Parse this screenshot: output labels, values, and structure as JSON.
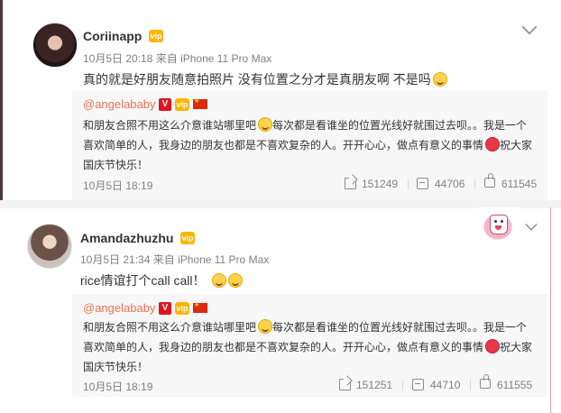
{
  "posts": [
    {
      "username": "Coriinapp",
      "time": "10月5日 20:18",
      "source": "来自 iPhone 11 Pro Max",
      "content": "真的就是好朋友随意拍照片 没有位置之分才是真朋友啊 不是吗",
      "repost": {
        "user": "@angelababy",
        "text_l1a": "和朋友合照不用这么介意谁站哪里吧",
        "text_l1b": "每次都是看谁坐的位置光线好就围过去呗。。我是一个",
        "text_l2a": "喜欢简单的人，我身边的朋友也都是不喜欢复杂的人。开开心心，做点有意义的事情",
        "text_l2b": "祝大家",
        "text_l3": "国庆节快乐！",
        "date": "10月5日 18:19",
        "reposts": "151249",
        "comments": "44706",
        "likes": "611545"
      }
    },
    {
      "username": "Amandazhuzhu",
      "time": "10月5日 21:34",
      "source": "来自 iPhone 11 Pro Max",
      "content": "rice情谊打个call call！",
      "repost": {
        "user": "@angelababy",
        "text_l1a": "和朋友合照不用这么介意谁站哪里吧",
        "text_l1b": "每次都是看谁坐的位置光线好就围过去呗。。我是一个",
        "text_l2a": "喜欢简单的人，我身边的朋友也都是不喜欢复杂的人。开开心心，做点有意义的事情",
        "text_l2b": "祝大家",
        "text_l3": "国庆节快乐！",
        "date": "10月5日 18:19",
        "reposts": "151251",
        "comments": "44710",
        "likes": "611555"
      }
    }
  ],
  "badges": {
    "verified": "V",
    "vip": "vip"
  },
  "icons": [
    "chevron-down-icon",
    "repost-icon",
    "comment-icon",
    "like-icon",
    "laugh-emoji-icon",
    "heart-emoji-icon",
    "sticker-icon"
  ],
  "colors": {
    "username_link": "#eb7350",
    "meta": "#808080",
    "repost_bg": "#f7f7f7"
  }
}
